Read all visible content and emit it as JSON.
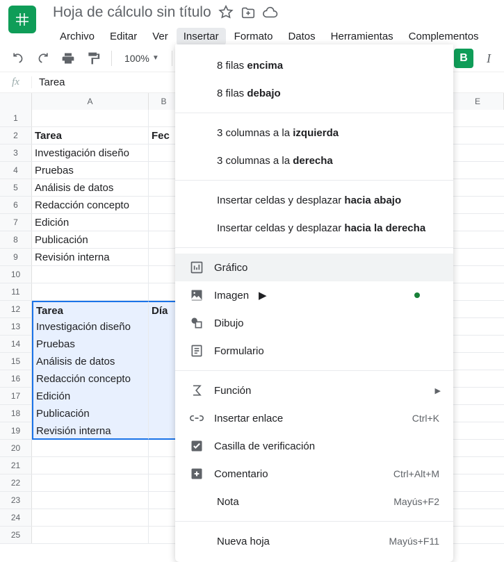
{
  "header": {
    "doc_title": "Hoja de cálculo sin título",
    "menu": {
      "archivo": "Archivo",
      "editar": "Editar",
      "ver": "Ver",
      "insertar": "Insertar",
      "formato": "Formato",
      "datos": "Datos",
      "herramientas": "Herramientas",
      "complementos": "Complementos"
    }
  },
  "toolbar": {
    "zoom": "100%",
    "bold": "B",
    "italic": "I"
  },
  "formula_bar": {
    "fx": "fx",
    "value": "Tarea"
  },
  "columns": {
    "A": "A",
    "B": "B",
    "E": "E"
  },
  "rows": [
    {
      "n": "1",
      "A": "",
      "B": ""
    },
    {
      "n": "2",
      "A": "Tarea",
      "B": "Fec",
      "bold": true
    },
    {
      "n": "3",
      "A": "Investigación diseño",
      "B": ""
    },
    {
      "n": "4",
      "A": "Pruebas",
      "B": ""
    },
    {
      "n": "5",
      "A": "Análisis de datos",
      "B": ""
    },
    {
      "n": "6",
      "A": "Redacción concepto",
      "B": ""
    },
    {
      "n": "7",
      "A": "Edición",
      "B": ""
    },
    {
      "n": "8",
      "A": "Publicación",
      "B": ""
    },
    {
      "n": "9",
      "A": "Revisión interna",
      "B": ""
    },
    {
      "n": "10",
      "A": "",
      "B": ""
    },
    {
      "n": "11",
      "A": "",
      "B": ""
    },
    {
      "n": "12",
      "A": "Tarea",
      "B": "Día",
      "bold": true,
      "sel": true,
      "head": true
    },
    {
      "n": "13",
      "A": "Investigación diseño",
      "B": "",
      "sel": true
    },
    {
      "n": "14",
      "A": "Pruebas",
      "B": "",
      "sel": true
    },
    {
      "n": "15",
      "A": "Análisis de datos",
      "B": "",
      "sel": true
    },
    {
      "n": "16",
      "A": "Redacción concepto",
      "B": "",
      "sel": true
    },
    {
      "n": "17",
      "A": "Edición",
      "B": "",
      "sel": true
    },
    {
      "n": "18",
      "A": "Publicación",
      "B": "",
      "sel": true
    },
    {
      "n": "19",
      "A": "Revisión interna",
      "B": "",
      "sel": true,
      "last": true
    },
    {
      "n": "20",
      "A": "",
      "B": ""
    },
    {
      "n": "21",
      "A": "",
      "B": ""
    },
    {
      "n": "22",
      "A": "",
      "B": ""
    },
    {
      "n": "23",
      "A": "",
      "B": ""
    },
    {
      "n": "24",
      "A": "",
      "B": ""
    },
    {
      "n": "25",
      "A": "",
      "B": ""
    }
  ],
  "dropdown": {
    "rows_above_pre": "8 filas ",
    "rows_above_b": "encima",
    "rows_below_pre": "8 filas ",
    "rows_below_b": "debajo",
    "cols_left_pre": "3 columnas a la ",
    "cols_left_b": "izquierda",
    "cols_right_pre": "3 columnas a la ",
    "cols_right_b": "derecha",
    "shift_down_pre": "Insertar celdas y desplazar ",
    "shift_down_b": "hacia abajo",
    "shift_right_pre": "Insertar celdas y desplazar ",
    "shift_right_b": "hacia la derecha",
    "chart": "Gráfico",
    "image": "Imagen",
    "drawing": "Dibujo",
    "form": "Formulario",
    "function": "Función",
    "link": "Insertar enlace",
    "link_sc": "Ctrl+K",
    "checkbox": "Casilla de verificación",
    "comment": "Comentario",
    "comment_sc": "Ctrl+Alt+M",
    "note": "Nota",
    "note_sc": "Mayús+F2",
    "newsheet": "Nueva hoja",
    "newsheet_sc": "Mayús+F11"
  }
}
